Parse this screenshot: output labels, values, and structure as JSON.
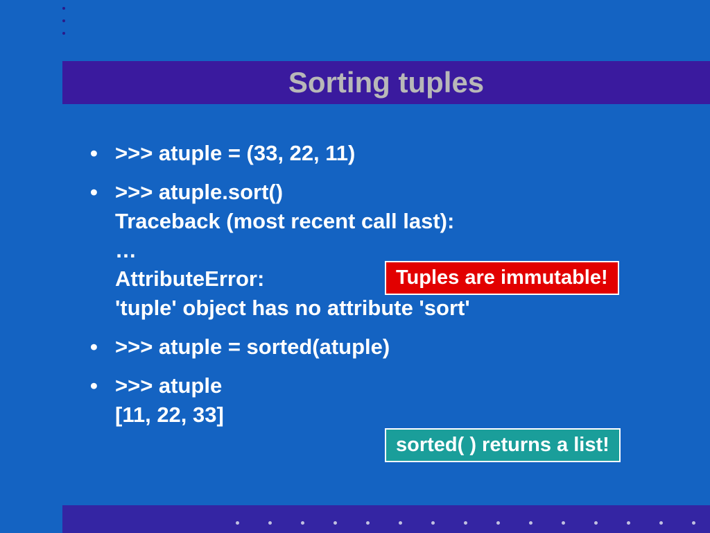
{
  "title": "Sorting tuples",
  "bullets": [
    {
      "lines": [
        ">>> atuple = (33, 22, 11)"
      ]
    },
    {
      "lines": [
        ">>> atuple.sort()",
        "Traceback (most recent call last):",
        "…",
        "AttributeError:",
        "'tuple' object has no attribute 'sort'"
      ]
    },
    {
      "lines": [
        ">>> atuple = sorted(atuple)"
      ]
    },
    {
      "lines": [
        ">>> atuple",
        "[11, 22, 33]"
      ]
    }
  ],
  "callout_red": "Tuples are immutable!",
  "callout_teal": "sorted( )  returns a list!"
}
